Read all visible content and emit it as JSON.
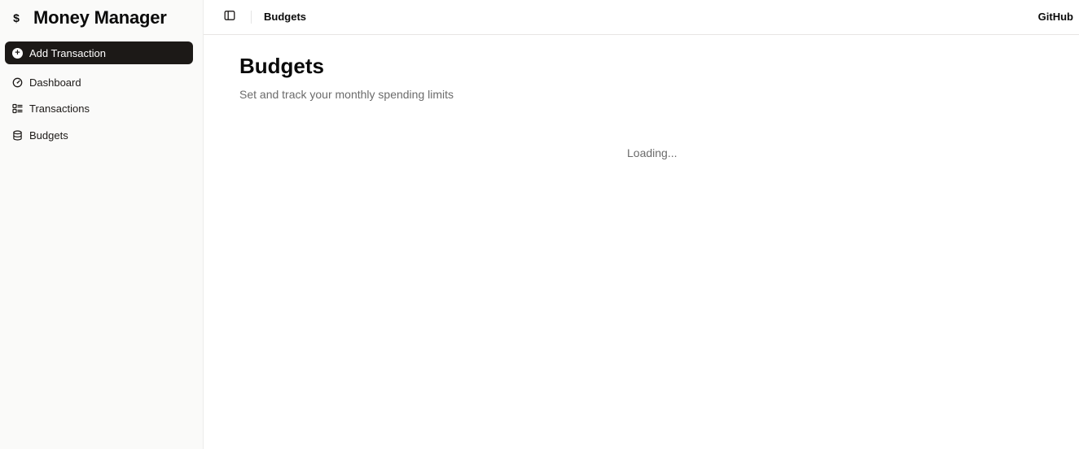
{
  "sidebar": {
    "brand": {
      "icon": "dollar-icon",
      "icon_glyph": "$",
      "title": "Money Manager"
    },
    "add_button": {
      "label": "Add Transaction",
      "icon": "plus-circle-icon"
    },
    "items": [
      {
        "label": "Dashboard",
        "icon": "gauge-icon"
      },
      {
        "label": "Transactions",
        "icon": "list-icon"
      },
      {
        "label": "Budgets",
        "icon": "database-icon"
      }
    ]
  },
  "header": {
    "toggle_icon": "sidebar-toggle-icon",
    "breadcrumb": "Budgets",
    "github_link": "GitHub"
  },
  "main": {
    "title": "Budgets",
    "subtitle": "Set and track your monthly spending limits",
    "status": "Loading..."
  },
  "colors": {
    "accent": "#1c1917",
    "sidebar_bg": "#fafaf9",
    "muted_text": "#6b6b6b",
    "border": "#e7e5e4"
  }
}
